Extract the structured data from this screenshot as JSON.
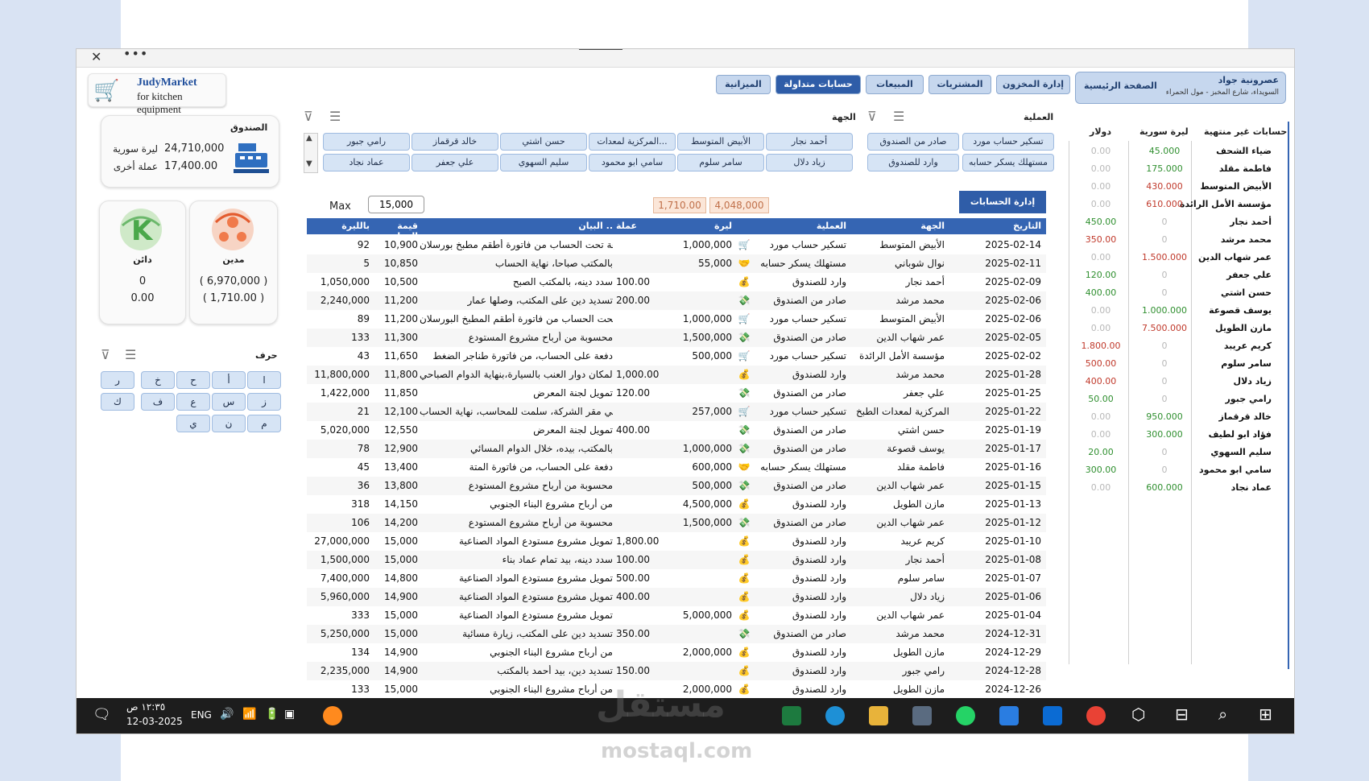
{
  "logo": {
    "name": "JudyMarket",
    "tagline": "for kitchen equipment",
    "icon": "cart-icon"
  },
  "tabs": [
    {
      "label": "الميزانية",
      "active": false
    },
    {
      "label": "حسابات متداولة",
      "active": true
    },
    {
      "label": "المبيعات",
      "active": false
    },
    {
      "label": "المشتريات",
      "active": false
    },
    {
      "label": "إدارة المخزون",
      "active": false
    }
  ],
  "home": {
    "label": "الصفحة الرئيسية",
    "company": "عصرونية جواد",
    "address": "السويداء، شارع المخبز - مول الحمراء"
  },
  "fund": {
    "title": "الصندوق",
    "lira_amount": "24,710,000",
    "lira_label": "ليرة سورية",
    "other_amount": "17,400.00",
    "other_label": "عملة أخرى",
    "icon": "cash-register-icon"
  },
  "debtor": {
    "title": "مدين",
    "lira": "( 6,970,000 )",
    "other": "( 1,710.00 )",
    "icon": "debtor-people-icon"
  },
  "creditor": {
    "title": "دائن",
    "lira": "0",
    "other": "0.00",
    "icon": "creditor-k-icon"
  },
  "letters": {
    "title": "حرف",
    "keys": [
      "ا",
      "أ",
      "ح",
      "خ",
      "ر",
      "ز",
      "س",
      "ع",
      "ف",
      "ك",
      "م",
      "ن",
      "ي"
    ]
  },
  "filters": {
    "operation_title": "العملية",
    "operations": [
      "تسكير حساب مورد",
      "صادر من الصندوق",
      "مستهلك يسكر حسابه",
      "وارد للصندوق"
    ],
    "party_title": "الجهة",
    "parties": [
      "أحمد نجار",
      "الأبيض المتوسط",
      "المركزية لمعدات...",
      "حسن اشتي",
      "خالد قرقماز",
      "رامي جبور",
      "زياد دلال",
      "سامر سلوم",
      "سامي ابو محمود",
      "سليم السهوي",
      "علي جعفر",
      "عماد نجاد"
    ]
  },
  "max": {
    "label": "Max",
    "value": "15,000"
  },
  "totals": {
    "currency": "1,710.00",
    "lira": "4,048,000"
  },
  "manage_button": "إدارة الحسابات",
  "grid": {
    "headers": {
      "date": "التاريخ",
      "party": "الجهة",
      "op": "العملية",
      "lira": "ليرة",
      "cur": "عملة",
      "desc": "البيان ..",
      "cv": "قيمة العملة",
      "bl": "بالليرة"
    },
    "rows": [
      {
        "date": "2025-02-14",
        "party": "الأبيض المتوسط",
        "op": "تسكير حساب مورد",
        "icon": "cart-icon",
        "lira": "1,000,000",
        "cur": "",
        "desc": "دفعة تحت الحساب من فاتورة أطقم مطبخ بورسلان",
        "cv": "10,900",
        "bl": "92"
      },
      {
        "date": "2025-02-11",
        "party": "نوال شوباني",
        "op": "مستهلك يسكر حسابه",
        "icon": "handshake-icon",
        "lira": "55,000",
        "cur": "",
        "desc": "بالمكتب صباحا، نهاية الحساب",
        "cv": "10,850",
        "bl": "5"
      },
      {
        "date": "2025-02-09",
        "party": "أحمد نجار",
        "op": "وارد للصندوق",
        "icon": "money-bag-icon",
        "lira": "",
        "cur": "100.00",
        "desc": "سدد دينه، بالمكتب الصبح",
        "cv": "10,500",
        "bl": "1,050,000"
      },
      {
        "date": "2025-02-06",
        "party": "محمد مرشد",
        "op": "صادر من الصندوق",
        "icon": "money-out-icon",
        "lira": "",
        "cur": "200.00",
        "desc": "تسديد دين على المكتب، وصلها عمار",
        "cv": "11,200",
        "bl": "2,240,000"
      },
      {
        "date": "2025-02-06",
        "party": "الأبيض المتوسط",
        "op": "تسكير حساب مورد",
        "icon": "cart-icon",
        "lira": "1,000,000",
        "cur": "",
        "desc": "دفعة تحت الحساب من فاتورة أطقم المطبخ البورسلان",
        "cv": "11,200",
        "bl": "89"
      },
      {
        "date": "2025-02-05",
        "party": "عمر شهاب الدين",
        "op": "صادر من الصندوق",
        "icon": "money-out-icon",
        "lira": "1,500,000",
        "cur": "",
        "desc": "محسوبة من أرباح مشروع المستودع",
        "cv": "11,300",
        "bl": "133"
      },
      {
        "date": "2025-02-02",
        "party": "مؤسسة الأمل الرائدة",
        "op": "تسكير حساب مورد",
        "icon": "cart-icon",
        "lira": "500,000",
        "cur": "",
        "desc": "دفعة على الحساب، من فاتورة طناجر الضغط",
        "cv": "11,650",
        "bl": "43"
      },
      {
        "date": "2025-01-28",
        "party": "محمد مرشد",
        "op": "وارد للصندوق",
        "icon": "money-bag-icon",
        "lira": "",
        "cur": "1,000.00",
        "desc": "المكان دوار العنب بالسيارة،بنهاية الدوام الصباحي",
        "cv": "11,800",
        "bl": "11,800,000"
      },
      {
        "date": "2025-01-25",
        "party": "علي جعفر",
        "op": "صادر من الصندوق",
        "icon": "money-out-icon",
        "lira": "",
        "cur": "120.00",
        "desc": "تمويل لجنة المعرض",
        "cv": "11,850",
        "bl": "1,422,000"
      },
      {
        "date": "2025-01-22",
        "party": "المركزية لمعدات الطبخ",
        "op": "تسكير حساب مورد",
        "icon": "cart-icon",
        "lira": "257,000",
        "cur": "",
        "desc": "في مقر الشركة، سلمت للمحاسب، نهاية الحساب",
        "cv": "12,100",
        "bl": "21"
      },
      {
        "date": "2025-01-19",
        "party": "حسن اشتي",
        "op": "صادر من الصندوق",
        "icon": "money-out-icon",
        "lira": "",
        "cur": "400.00",
        "desc": "تمويل لجنة المعرض",
        "cv": "12,550",
        "bl": "5,020,000"
      },
      {
        "date": "2025-01-17",
        "party": "يوسف قصوعة",
        "op": "صادر من الصندوق",
        "icon": "money-out-icon",
        "lira": "1,000,000",
        "cur": "",
        "desc": "بالمكتب، بيده، خلال الدوام المسائي",
        "cv": "12,900",
        "bl": "78"
      },
      {
        "date": "2025-01-16",
        "party": "فاطمة مقلد",
        "op": "مستهلك يسكر حسابه",
        "icon": "handshake-icon",
        "lira": "600,000",
        "cur": "",
        "desc": "دفعة على الحساب، من فاتورة المتة",
        "cv": "13,400",
        "bl": "45"
      },
      {
        "date": "2025-01-15",
        "party": "عمر شهاب الدين",
        "op": "صادر من الصندوق",
        "icon": "money-out-icon",
        "lira": "500,000",
        "cur": "",
        "desc": "محسوبة من أرباح مشروع المستودع",
        "cv": "13,800",
        "bl": "36"
      },
      {
        "date": "2025-01-13",
        "party": "مازن الطويل",
        "op": "وارد للصندوق",
        "icon": "money-bag-icon",
        "lira": "4,500,000",
        "cur": "",
        "desc": "من أرباح مشروع البناء الجنوبي",
        "cv": "14,150",
        "bl": "318"
      },
      {
        "date": "2025-01-12",
        "party": "عمر شهاب الدين",
        "op": "صادر من الصندوق",
        "icon": "money-out-icon",
        "lira": "1,500,000",
        "cur": "",
        "desc": "محسوبة من أرباح مشروع المستودع",
        "cv": "14,200",
        "bl": "106"
      },
      {
        "date": "2025-01-10",
        "party": "كريم عريبد",
        "op": "وارد للصندوق",
        "icon": "money-bag-icon",
        "lira": "",
        "cur": "1,800.00",
        "desc": "تمويل مشروع مستودع المواد الصناعية",
        "cv": "15,000",
        "bl": "27,000,000"
      },
      {
        "date": "2025-01-08",
        "party": "أحمد نجار",
        "op": "وارد للصندوق",
        "icon": "money-bag-icon",
        "lira": "",
        "cur": "100.00",
        "desc": "سدد دينه، بيد تمام عماد بناء",
        "cv": "15,000",
        "bl": "1,500,000"
      },
      {
        "date": "2025-01-07",
        "party": "سامر سلوم",
        "op": "وارد للصندوق",
        "icon": "money-bag-icon",
        "lira": "",
        "cur": "500.00",
        "desc": "تمويل مشروع مستودع المواد الصناعية",
        "cv": "14,800",
        "bl": "7,400,000"
      },
      {
        "date": "2025-01-06",
        "party": "زياد دلال",
        "op": "وارد للصندوق",
        "icon": "money-bag-icon",
        "lira": "",
        "cur": "400.00",
        "desc": "تمويل مشروع مستودع المواد الصناعية",
        "cv": "14,900",
        "bl": "5,960,000"
      },
      {
        "date": "2025-01-04",
        "party": "عمر شهاب الدين",
        "op": "وارد للصندوق",
        "icon": "money-bag-icon",
        "lira": "5,000,000",
        "cur": "",
        "desc": "تمويل مشروع مستودع المواد الصناعية",
        "cv": "15,000",
        "bl": "333"
      },
      {
        "date": "2024-12-31",
        "party": "محمد مرشد",
        "op": "صادر من الصندوق",
        "icon": "money-out-icon",
        "lira": "",
        "cur": "350.00",
        "desc": "تسديد دين على المكتب، زيارة مسائية",
        "cv": "15,000",
        "bl": "5,250,000"
      },
      {
        "date": "2024-12-29",
        "party": "مازن الطويل",
        "op": "وارد للصندوق",
        "icon": "money-bag-icon",
        "lira": "2,000,000",
        "cur": "",
        "desc": "من أرباح مشروع البناء الجنوبي",
        "cv": "14,900",
        "bl": "134"
      },
      {
        "date": "2024-12-28",
        "party": "رامي جبور",
        "op": "وارد للصندوق",
        "icon": "money-bag-icon",
        "lira": "",
        "cur": "150.00",
        "desc": "تسديد دين، بيد أحمد بالمكتب",
        "cv": "14,900",
        "bl": "2,235,000"
      },
      {
        "date": "2024-12-26",
        "party": "مازن الطويل",
        "op": "وارد للصندوق",
        "icon": "money-bag-icon",
        "lira": "2,000,000",
        "cur": "",
        "desc": "من أرباح مشروع البناء الجنوبي",
        "cv": "15,000",
        "bl": "133"
      }
    ]
  },
  "open_accounts": {
    "title": "حسابات غير منتهية",
    "col_lira": "ليرة سورية",
    "col_usd": "دولار",
    "rows": [
      {
        "name": "ضياء الشحف",
        "lira": "45.000",
        "usd": "0.00",
        "lc": "grn",
        "uc": "gry"
      },
      {
        "name": "فاطمة مقلد",
        "lira": "175.000",
        "usd": "0.00",
        "lc": "grn",
        "uc": "gry"
      },
      {
        "name": "الأبيض المتوسط",
        "lira": "430.000",
        "usd": "0.00",
        "lc": "red",
        "uc": "gry"
      },
      {
        "name": "مؤسسة الأمل الرائدة",
        "lira": "610.000",
        "usd": "0.00",
        "lc": "red",
        "uc": "gry"
      },
      {
        "name": "أحمد نجار",
        "lira": "0",
        "usd": "450.00",
        "lc": "gry",
        "uc": "grn"
      },
      {
        "name": "محمد مرشد",
        "lira": "0",
        "usd": "350.00",
        "lc": "gry",
        "uc": "red"
      },
      {
        "name": "عمر شهاب الدين",
        "lira": "1.500.000",
        "usd": "0.00",
        "lc": "red",
        "uc": "gry"
      },
      {
        "name": "علي جعفر",
        "lira": "0",
        "usd": "120.00",
        "lc": "gry",
        "uc": "grn"
      },
      {
        "name": "حسن اشتي",
        "lira": "0",
        "usd": "400.00",
        "lc": "gry",
        "uc": "grn"
      },
      {
        "name": "يوسف قصوعة",
        "lira": "1.000.000",
        "usd": "0.00",
        "lc": "grn",
        "uc": "gry"
      },
      {
        "name": "مازن الطويل",
        "lira": "7.500.000",
        "usd": "0.00",
        "lc": "red",
        "uc": "gry"
      },
      {
        "name": "كريم عريبد",
        "lira": "0",
        "usd": "1.800.00",
        "lc": "gry",
        "uc": "red"
      },
      {
        "name": "سامر سلوم",
        "lira": "0",
        "usd": "500.00",
        "lc": "gry",
        "uc": "red"
      },
      {
        "name": "زياد دلال",
        "lira": "0",
        "usd": "400.00",
        "lc": "gry",
        "uc": "red"
      },
      {
        "name": "رامي جبور",
        "lira": "0",
        "usd": "50.00",
        "lc": "gry",
        "uc": "grn"
      },
      {
        "name": "خالد قرقماز",
        "lira": "950.000",
        "usd": "0.00",
        "lc": "grn",
        "uc": "gry"
      },
      {
        "name": "فؤاد ابو لطيف",
        "lira": "300.000",
        "usd": "0.00",
        "lc": "grn",
        "uc": "gry"
      },
      {
        "name": "سليم السهوي",
        "lira": "0",
        "usd": "20.00",
        "lc": "gry",
        "uc": "grn"
      },
      {
        "name": "سامي ابو محمود",
        "lira": "0",
        "usd": "300.00",
        "lc": "gry",
        "uc": "grn"
      },
      {
        "name": "عماد نجاد",
        "lira": "600.000",
        "usd": "0.00",
        "lc": "grn",
        "uc": "gry"
      }
    ]
  },
  "taskbar": {
    "time": "١٢:٣٥ ص",
    "date": "12-03-2025",
    "lang": "ENG"
  },
  "watermark": {
    "arabic": "مستقل",
    "latin": "mostaql.com"
  }
}
